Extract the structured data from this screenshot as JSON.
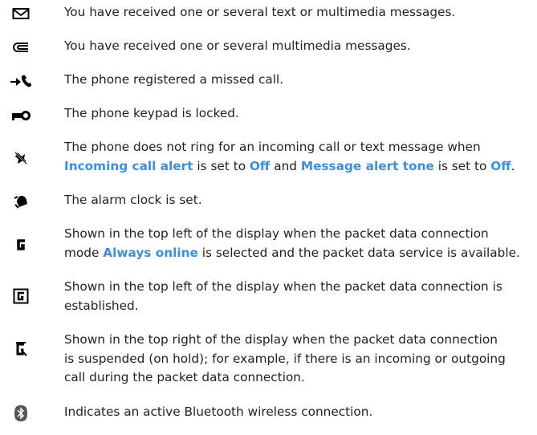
{
  "colors": {
    "text": "#231f20",
    "keyword": "#3d8ede",
    "icon": "#000000"
  },
  "items": [
    {
      "icon": "envelope-icon",
      "parts": [
        "You have received one or several text or multimedia messages."
      ]
    },
    {
      "icon": "multimedia-message-icon",
      "parts": [
        "You have received one or several multimedia messages."
      ]
    },
    {
      "icon": "missed-call-icon",
      "parts": [
        "The phone registered a missed call."
      ]
    },
    {
      "icon": "keypad-lock-icon",
      "parts": [
        "The phone keypad is locked."
      ]
    },
    {
      "icon": "silent-icon",
      "line1": "The phone does not ring for an incoming call or text message when",
      "kw1": "Incoming call alert",
      "t1": " is set to ",
      "kw2": "Off",
      "t2": " and ",
      "kw3": "Message alert tone",
      "t3": " is set to ",
      "kw4": "Off",
      "t4": "."
    },
    {
      "icon": "alarm-clock-icon",
      "parts": [
        "The alarm clock is set."
      ]
    },
    {
      "icon": "gprs-always-online-icon",
      "line1": "Shown in the top left of the display when the packet data connection",
      "t0": "mode ",
      "kw1": "Always online",
      "t1": " is selected and the packet data service is available."
    },
    {
      "icon": "gprs-established-icon",
      "line1": "Shown in the top left of the display when the packet data connection is",
      "line2": "established."
    },
    {
      "icon": "gprs-suspended-icon",
      "line1": "Shown in the top right of the display when the packet data connection",
      "line2": "is suspended (on hold); for example, if there is an incoming or outgoing",
      "line3": "call during the packet data connection."
    },
    {
      "icon": "bluetooth-icon",
      "parts": [
        "Indicates an active Bluetooth wireless connection."
      ]
    }
  ]
}
